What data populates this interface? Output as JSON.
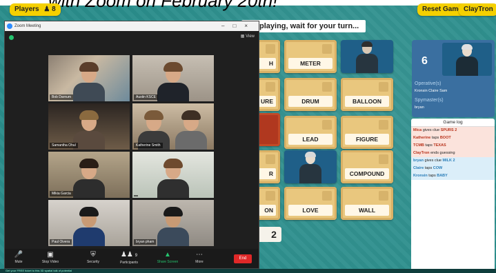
{
  "top": {
    "cut_title": "with Zoom on February 20th!",
    "players_label": "Players",
    "players_count": "8",
    "reset_label": "Reset Game",
    "user_label": "ClayTron",
    "status": "playing, wait for your turn..."
  },
  "board": {
    "words": [
      "H",
      "METER",
      "URE",
      "DRUM",
      "BALLOON",
      "LEAD",
      "FIGURE",
      "R",
      "COMPOUND",
      "ON",
      "LOVE",
      "WALL"
    ],
    "pages": [
      "",
      "2"
    ]
  },
  "team_panel": {
    "count": "6",
    "operatives_label": "Operative(s)",
    "operatives_names": "Kronsin  Claire  Sam",
    "spymaster_label": "Spymaster(s)",
    "spymaster_names": "bryan"
  },
  "game_log": {
    "title": "Game log",
    "entries": [
      {
        "name": "Mica",
        "text": " gives clue ",
        "word": "SPURS 2",
        "team": "red"
      },
      {
        "name": "Katherine",
        "text": " taps ",
        "word": "BOOT",
        "team": "red"
      },
      {
        "name": "TCMB",
        "text": " taps ",
        "word": "TEXAS",
        "team": "red"
      },
      {
        "name": "ClayTron",
        "text": " ends guessing",
        "word": "",
        "team": "red"
      },
      {
        "name": "bryan",
        "text": " gives clue ",
        "word": "MILK 2",
        "team": "blue"
      },
      {
        "name": "Claire",
        "text": " taps ",
        "word": "COW",
        "team": "blue"
      },
      {
        "name": "Kronsin",
        "text": " taps ",
        "word": "BABY",
        "team": "blue"
      }
    ]
  },
  "zoom": {
    "title": "Zoom Meeting",
    "view_label": "View",
    "participants": [
      "Bob Darnum",
      "Austin KSCE",
      "Samantha Ohul",
      "Katherine Smith",
      "",
      "Mikia Garcia",
      "",
      "Paul Oivera",
      "bryan pham"
    ],
    "toolbar": {
      "mute": "Mute",
      "stop_video": "Stop Video",
      "security": "Security",
      "participants": "Participants",
      "participants_count": "9",
      "share": "Share Screen",
      "more": "More",
      "end": "End"
    }
  },
  "ticker": "Get your FREE ticket to this 3D spatial talk of potential"
}
